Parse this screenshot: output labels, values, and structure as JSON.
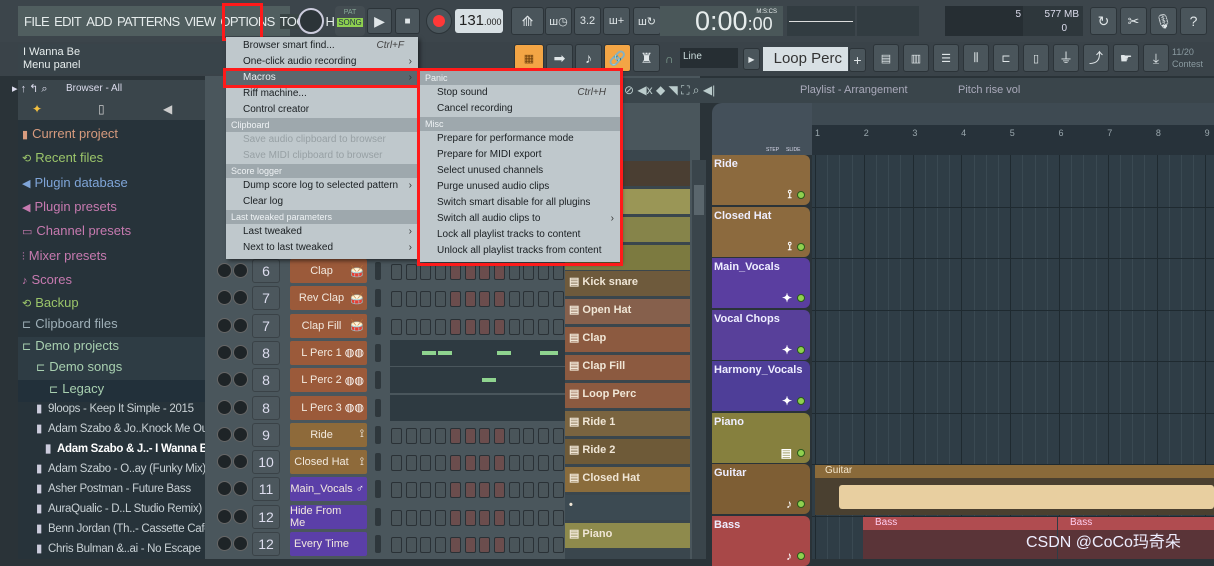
{
  "menubar": {
    "items": [
      "FILE",
      "EDIT",
      "ADD",
      "PATTERNS",
      "VIEW",
      "OPTIONS",
      "TOOLS",
      "HELP"
    ],
    "highlighted": "TOOLS"
  },
  "transport": {
    "pat": "PAT",
    "song": "SONG",
    "tempo": "131",
    "tempo_frac": ".000",
    "time": "0:00",
    "time_cs": ":00",
    "time_format": "M:S:CS"
  },
  "monitor": {
    "cpu": "5",
    "memory": "577 MB",
    "poly": "0"
  },
  "hint": {
    "line1": "I Wanna Be",
    "line2": "Menu panel"
  },
  "toolbar": {
    "snap": "Line",
    "pattern": "Loop Perc",
    "news_count": "11/20",
    "news_label": "Contest"
  },
  "browser": {
    "title": "Browser - All",
    "items": [
      {
        "label": "Current project",
        "color": "#d79b7e"
      },
      {
        "label": "Recent files",
        "color": "#9bc56a"
      },
      {
        "label": "Plugin database",
        "color": "#7fa5d8"
      },
      {
        "label": "Plugin presets",
        "color": "#c77ab0"
      },
      {
        "label": "Channel presets",
        "color": "#c77ab0"
      },
      {
        "label": "Mixer presets",
        "color": "#c77ab0"
      },
      {
        "label": "Scores",
        "color": "#c77ab0"
      },
      {
        "label": "Backup",
        "color": "#9bc56a"
      },
      {
        "label": "Clipboard files",
        "color": "#9fb0b8"
      },
      {
        "label": "Demo projects",
        "color": "#a8d0b0"
      },
      {
        "label": "Demo songs",
        "color": "#a8d0b0"
      },
      {
        "label": "Legacy",
        "color": "#a8d0b0"
      }
    ],
    "files": [
      "9loops - Keep It Simple - 2015",
      "Adam Szabo & Jo..Knock Me Out",
      "Adam Szabo & J..- I Wanna Be",
      "Adam Szabo - O..ay (Funky Mix)",
      "Asher Postman - Future Bass",
      "AuraQualic - D..L Studio Remix)",
      "Benn Jordan (Th..- Cassette Cafe",
      "Chris Bulman &..ai - No Escape"
    ]
  },
  "channels": [
    {
      "num": "6",
      "name": "Clap",
      "color": "#9b5a3a",
      "icon": "drum"
    },
    {
      "num": "7",
      "name": "Rev Clap",
      "color": "#9b5a3a",
      "icon": "drum"
    },
    {
      "num": "7",
      "name": "Clap Fill",
      "color": "#9b5a3a",
      "icon": "drum"
    },
    {
      "num": "8",
      "name": "L Perc 1",
      "color": "#9b5a3a",
      "icon": "bongo"
    },
    {
      "num": "8",
      "name": "L Perc 2",
      "color": "#9b5a3a",
      "icon": "bongo"
    },
    {
      "num": "8",
      "name": "L Perc 3",
      "color": "#9b5a3a",
      "icon": "bongo"
    },
    {
      "num": "9",
      "name": "Ride",
      "color": "#8e6a3a",
      "icon": "cymbal"
    },
    {
      "num": "10",
      "name": "Closed Hat",
      "color": "#8e6a3a",
      "icon": "cymbal"
    },
    {
      "num": "11",
      "name": "Main_Vocals",
      "color": "#5b3fa8",
      "icon": "mic"
    },
    {
      "num": "12",
      "name": "Hide From Me",
      "color": "#5b3fa8",
      "icon": ""
    },
    {
      "num": "12",
      "name": "Every Time",
      "color": "#5b3fa8",
      "icon": ""
    }
  ],
  "patterns": [
    {
      "name": "Kick snare",
      "color": "#6e5a3c"
    },
    {
      "name": "Open Hat",
      "color": "#86604c"
    },
    {
      "name": "Clap",
      "color": "#8c5a40"
    },
    {
      "name": "Clap Fill",
      "color": "#8c5a40"
    },
    {
      "name": "Loop Perc",
      "color": "#8c5a40"
    },
    {
      "name": "Ride 1",
      "color": "#7a6440"
    },
    {
      "name": "Ride 2",
      "color": "#6e5a38"
    },
    {
      "name": "Closed Hat",
      "color": "#8a6c3c"
    },
    {
      "name": "",
      "color": "#3c4a52"
    },
    {
      "name": "Piano",
      "color": "#8e8a4c"
    }
  ],
  "playlist": {
    "title": "Playlist - Arrangement",
    "breadcrumb": "Pitch rise vol",
    "step": "STEP",
    "slide": "SLIDE",
    "bars": [
      "1",
      "2",
      "3",
      "4",
      "5",
      "6",
      "7",
      "8",
      "9"
    ],
    "tracks": [
      {
        "name": "Ride",
        "color": "#8c6a3e",
        "icon": "cymbal"
      },
      {
        "name": "Closed Hat",
        "color": "#8c6a3e",
        "icon": "cymbal"
      },
      {
        "name": "Main_Vocals",
        "color": "#5a3ea0",
        "icon": "wave"
      },
      {
        "name": "Vocal Chops",
        "color": "#58409a",
        "icon": "wave"
      },
      {
        "name": "Harmony_Vocals",
        "color": "#4e3e98",
        "icon": "wave"
      },
      {
        "name": "Piano",
        "color": "#86803e",
        "icon": "piano"
      },
      {
        "name": "Guitar",
        "color": "#7e5e34",
        "icon": "guitar"
      },
      {
        "name": "Bass",
        "color": "#a84848",
        "icon": "guitar"
      }
    ],
    "clips": {
      "guitar": "Guitar",
      "bass1": "Bass",
      "bass2": "Bass"
    }
  },
  "tools_menu": [
    {
      "type": "item",
      "label": "Browser smart find...",
      "shortcut": "Ctrl+F"
    },
    {
      "type": "item",
      "label": "One-click audio recording",
      "arrow": true
    },
    {
      "type": "item",
      "label": "Macros",
      "arrow": true,
      "hl": true
    },
    {
      "type": "item",
      "label": "Riff machine..."
    },
    {
      "type": "item",
      "label": "Control creator"
    },
    {
      "type": "head",
      "label": "Clipboard"
    },
    {
      "type": "item",
      "label": "Save audio clipboard to browser",
      "dis": true
    },
    {
      "type": "item",
      "label": "Save MIDI clipboard to browser",
      "dis": true
    },
    {
      "type": "head",
      "label": "Score logger"
    },
    {
      "type": "item",
      "label": "Dump score log to selected pattern",
      "arrow": true
    },
    {
      "type": "item",
      "label": "Clear log"
    },
    {
      "type": "head",
      "label": "Last tweaked parameters"
    },
    {
      "type": "item",
      "label": "Last tweaked",
      "arrow": true
    },
    {
      "type": "item",
      "label": "Next to last tweaked",
      "arrow": true
    }
  ],
  "macros_menu": [
    {
      "type": "head",
      "label": "Panic"
    },
    {
      "type": "item",
      "label": "Stop sound",
      "shortcut": "Ctrl+H"
    },
    {
      "type": "item",
      "label": "Cancel recording"
    },
    {
      "type": "head",
      "label": "Misc"
    },
    {
      "type": "item",
      "label": "Prepare for performance mode"
    },
    {
      "type": "item",
      "label": "Prepare for MIDI export"
    },
    {
      "type": "item",
      "label": "Select unused channels"
    },
    {
      "type": "item",
      "label": "Purge unused audio clips"
    },
    {
      "type": "item",
      "label": "Switch smart disable for all plugins"
    },
    {
      "type": "item",
      "label": "Switch all audio clips to",
      "arrow": true
    },
    {
      "type": "item",
      "label": "Lock all playlist tracks to content"
    },
    {
      "type": "item",
      "label": "Unlock all playlist tracks from content"
    }
  ],
  "watermark": "CSDN @CoCo玛奇朵",
  "colors": {
    "highlight": "#ff1a1a",
    "accent": "#f3a545",
    "led": "#8fd14f"
  }
}
